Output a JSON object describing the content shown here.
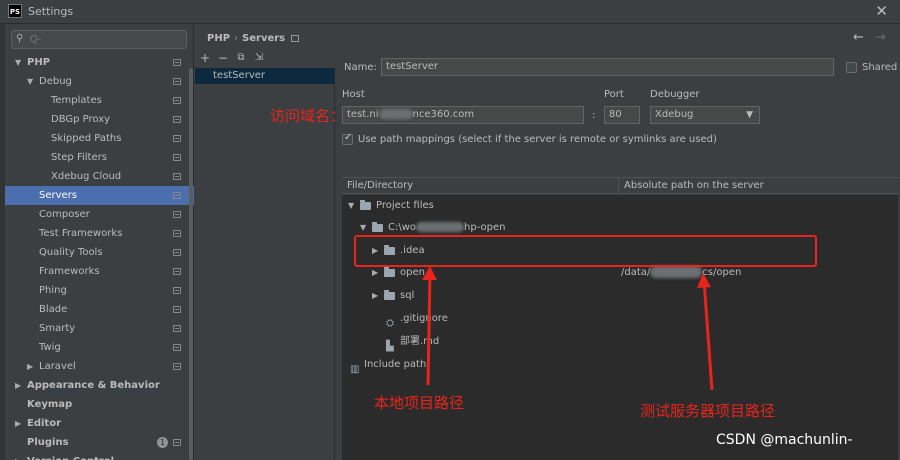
{
  "window": {
    "title": "Settings",
    "app_icon": "PS"
  },
  "search": {
    "placeholder": "Q-",
    "value": ""
  },
  "sidebar": {
    "items": [
      {
        "label": "PHP",
        "level": 0,
        "expanded": true,
        "bold": true
      },
      {
        "label": "Debug",
        "level": 1,
        "expanded": true
      },
      {
        "label": "Templates",
        "level": 2
      },
      {
        "label": "DBGp Proxy",
        "level": 2
      },
      {
        "label": "Skipped Paths",
        "level": 2
      },
      {
        "label": "Step Filters",
        "level": 2
      },
      {
        "label": "Xdebug Cloud",
        "level": 2
      },
      {
        "label": "Servers",
        "level": 1,
        "selected": true
      },
      {
        "label": "Composer",
        "level": 1
      },
      {
        "label": "Test Frameworks",
        "level": 1
      },
      {
        "label": "Quality Tools",
        "level": 1
      },
      {
        "label": "Frameworks",
        "level": 1
      },
      {
        "label": "Phing",
        "level": 1
      },
      {
        "label": "Blade",
        "level": 1
      },
      {
        "label": "Smarty",
        "level": 1
      },
      {
        "label": "Twig",
        "level": 1
      },
      {
        "label": "Laravel",
        "level": 1,
        "collapsed": true
      },
      {
        "label": "Appearance & Behavior",
        "level": 0,
        "collapsed": true,
        "bold": true
      },
      {
        "label": "Keymap",
        "level": 0,
        "bold": true
      },
      {
        "label": "Editor",
        "level": 0,
        "collapsed": true,
        "bold": true
      },
      {
        "label": "Plugins",
        "level": 0,
        "bold": true,
        "badge": "1"
      },
      {
        "label": "Version Control",
        "level": 0,
        "collapsed": true,
        "bold": true
      }
    ]
  },
  "breadcrumb": {
    "parent": "PHP",
    "separator": "›",
    "current": "Servers"
  },
  "server_list": {
    "items": [
      "testServer"
    ]
  },
  "form": {
    "name_label": "Name:",
    "name_value": "testServer",
    "shared_label": "Shared",
    "host_label": "Host",
    "host_value_prefix": "test.ni",
    "host_value_suffix": "nce360.com",
    "port_label": "Port",
    "port_value": "80",
    "colon": ":",
    "debugger_label": "Debugger",
    "debugger_value": "Xdebug",
    "use_mappings_label": "Use path mappings (select if the server is remote or symlinks are used)",
    "col_file": "File/Directory",
    "col_abs": "Absolute path on the server"
  },
  "mappings": {
    "project_files": "Project files",
    "root_prefix": "C:\\wo",
    "root_suffix": "hp-open",
    "idea": ".idea",
    "open": "open",
    "open_path_prefix": "/data/",
    "open_path_suffix": "cs/open",
    "sql": "sql",
    "gitignore": ".gitignore",
    "md": "部署.md",
    "include_path": "Include path"
  },
  "annotations": {
    "domain": "访问域名：",
    "local": "本地项目路径",
    "server": "测试服务器项目路径"
  },
  "watermark": "CSDN @machunlin-",
  "colors": {
    "annotation": "#e8251c",
    "selection": "#4b6eaf",
    "bg": "#3c3f41",
    "tree_bg": "#2b2b2b"
  }
}
